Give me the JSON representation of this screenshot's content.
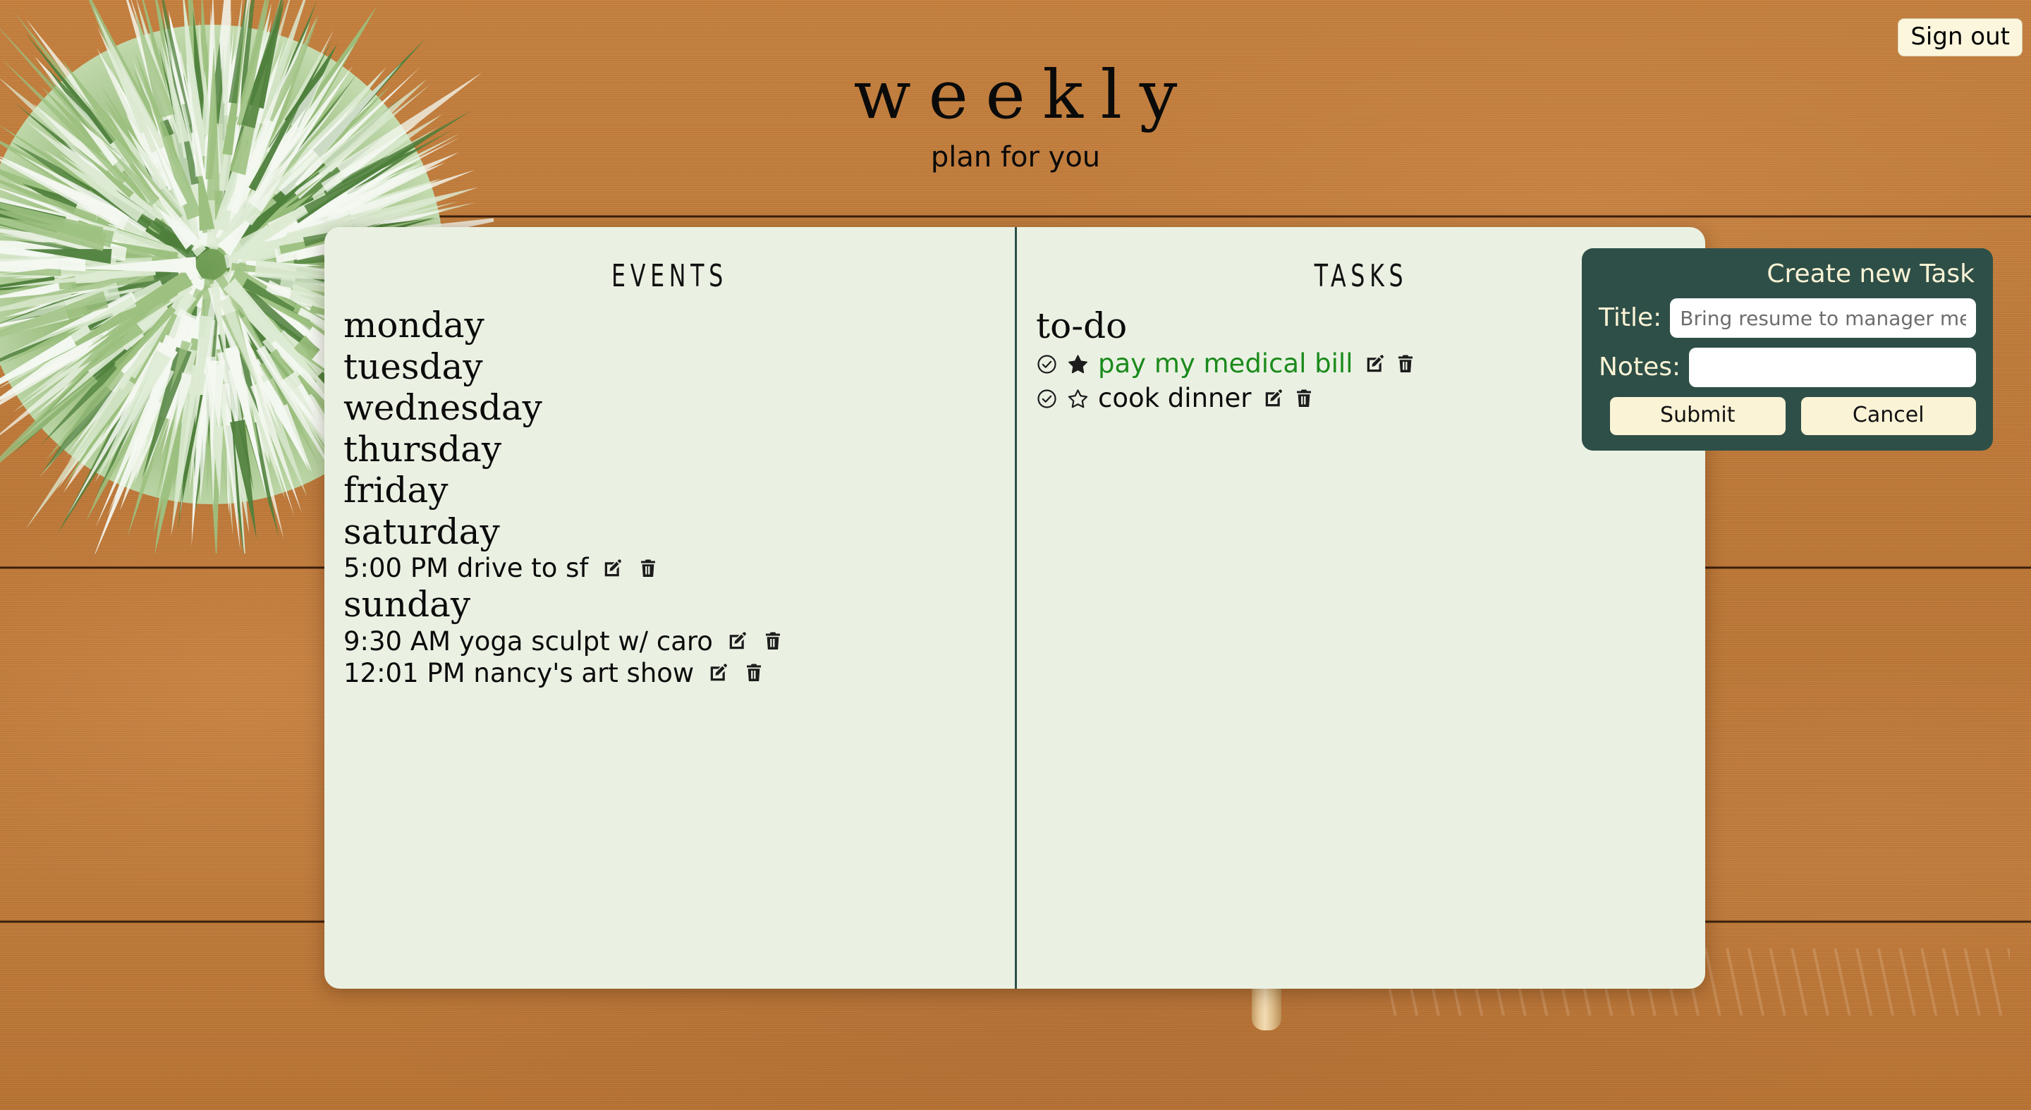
{
  "header": {
    "title": "weekly",
    "subtitle": "plan for you",
    "sign_out_label": "Sign out"
  },
  "colors": {
    "wood": "#c07c3c",
    "page": "#eaf1e3",
    "panel": "#2e4f47",
    "cream": "#fbf3d6",
    "done_green": "#1b8a1b",
    "divider": "#2f4f47"
  },
  "notebook": {
    "events": {
      "heading": "EVENTS",
      "days": [
        {
          "name": "monday",
          "events": []
        },
        {
          "name": "tuesday",
          "events": []
        },
        {
          "name": "wednesday",
          "events": []
        },
        {
          "name": "thursday",
          "events": []
        },
        {
          "name": "friday",
          "events": []
        },
        {
          "name": "saturday",
          "events": [
            {
              "text": "5:00 PM drive to sf"
            }
          ]
        },
        {
          "name": "sunday",
          "events": [
            {
              "text": "9:30 AM yoga sculpt w/ caro"
            },
            {
              "text": "12:01 PM nancy's art show"
            }
          ]
        }
      ]
    },
    "tasks": {
      "heading": "TASKS",
      "list_heading": "to-do",
      "items": [
        {
          "text": "pay my medical bill",
          "starred": true,
          "completed": true
        },
        {
          "text": "cook dinner",
          "starred": false,
          "completed": false
        }
      ]
    },
    "icons": {
      "edit": "edit-icon",
      "delete": "trash-icon",
      "check": "check-circle-icon",
      "star_filled": "star-filled-icon",
      "star_outline": "star-outline-icon"
    }
  },
  "create_task_panel": {
    "title": "Create new Task",
    "title_label": "Title:",
    "title_value": "",
    "title_placeholder": "Bring resume to manager meeting",
    "notes_label": "Notes:",
    "notes_value": "",
    "notes_placeholder": "",
    "submit_label": "Submit",
    "cancel_label": "Cancel"
  }
}
